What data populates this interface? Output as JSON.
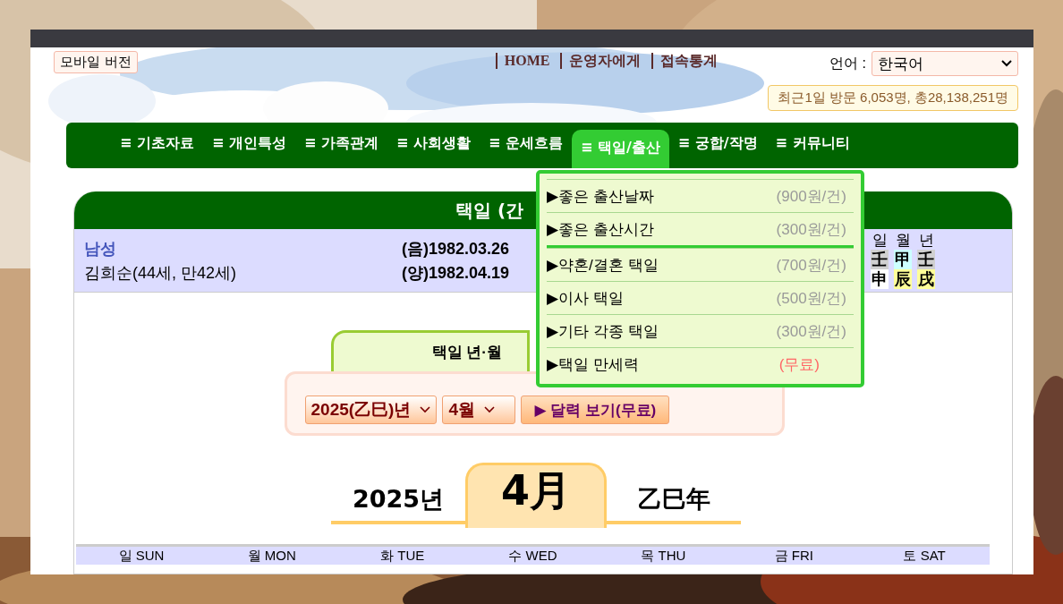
{
  "header": {
    "mobile_button": "모바일 버전",
    "links": [
      "HOME",
      "운영자에게",
      "접속통계"
    ],
    "language_label": "언어 :",
    "language_value": "한국어",
    "visit_counter": "최근1일 방문 6,053명, 총28,138,251명"
  },
  "nav": [
    {
      "label": "≡ 기초자료",
      "selected": false
    },
    {
      "label": "≡ 개인특성",
      "selected": false
    },
    {
      "label": "≡ 가족관계",
      "selected": false
    },
    {
      "label": "≡ 사회생활",
      "selected": false
    },
    {
      "label": "≡ 운세흐름",
      "selected": false
    },
    {
      "label": "≡ 택일/출산",
      "selected": true
    },
    {
      "label": "≡ 궁합/작명",
      "selected": false
    },
    {
      "label": "≡ 커뮤니티",
      "selected": false
    }
  ],
  "dropdown": [
    {
      "label": "▶좋은 출산날짜",
      "price": "(900원/건)",
      "kind": "paid",
      "group_end": false
    },
    {
      "label": "▶좋은 출산시간",
      "price": "(300원/건)",
      "kind": "paid",
      "group_end": true
    },
    {
      "label": "▶약혼/결혼 택일",
      "price": "(700원/건)",
      "kind": "paid",
      "group_end": false
    },
    {
      "label": "▶이사 택일",
      "price": "(500원/건)",
      "kind": "paid",
      "group_end": false
    },
    {
      "label": "▶기타 각종 택일",
      "price": "(300원/건)",
      "kind": "paid",
      "group_end": false
    },
    {
      "label": "▶택일 만세력",
      "price": "(무료)",
      "kind": "free",
      "group_end": false
    }
  ],
  "card": {
    "title": "택일 (간",
    "gender": "남성",
    "name": "김희순(44세, 만42세)",
    "lunar": "(음)1982.03.26",
    "solar": "(양)1982.04.19",
    "pillars": [
      {
        "label": "일",
        "chars": [
          {
            "char": "壬",
            "color": "#d0d0d0"
          },
          {
            "char": "申",
            "color": "#ffffff"
          }
        ]
      },
      {
        "label": "월",
        "chars": [
          {
            "char": "甲",
            "color": "#ccffff"
          },
          {
            "char": "辰",
            "color": "#ffff99"
          }
        ]
      },
      {
        "label": "년",
        "chars": [
          {
            "char": "壬",
            "color": "#d0d0d0"
          },
          {
            "char": "戌",
            "color": "#ffff99"
          }
        ]
      }
    ]
  },
  "picker": {
    "tab": "택일 년·월",
    "year": "2025(乙巳)년",
    "month": "4월",
    "button": "▶ 달력 보기(무료)"
  },
  "month_display": {
    "year": "2025년",
    "month": "4月",
    "ganji": "乙巳年"
  },
  "weekdays": [
    "일 SUN",
    "월 MON",
    "화 TUE",
    "수 WED",
    "목 THU",
    "금 FRI",
    "토 SAT"
  ]
}
